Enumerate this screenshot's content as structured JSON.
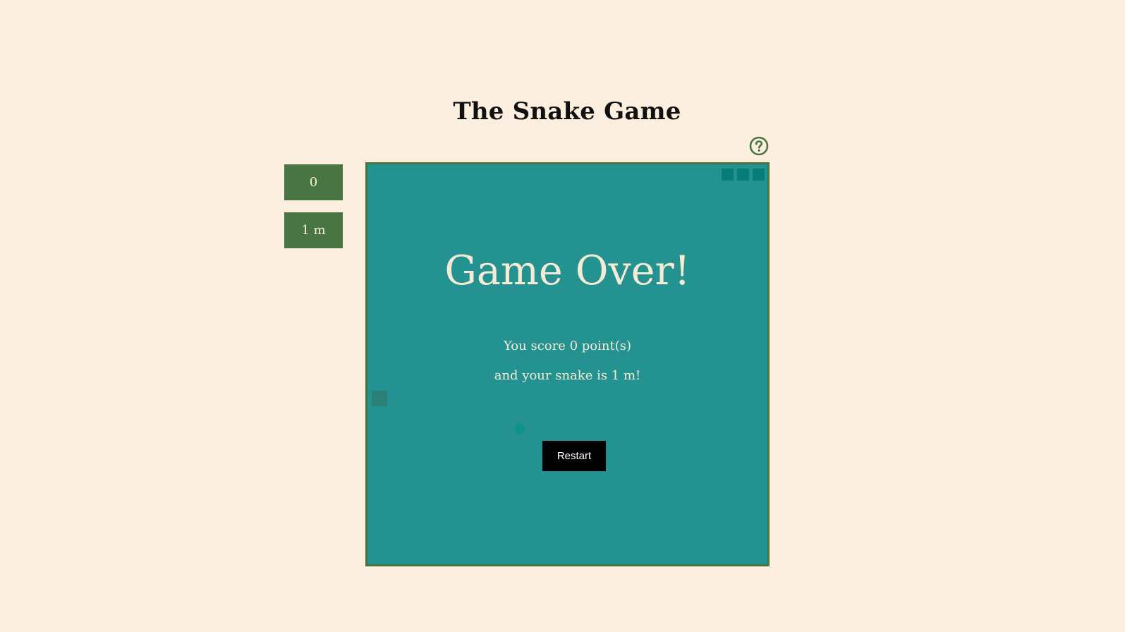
{
  "header": {
    "title": "The Snake Game"
  },
  "help": {
    "icon": "question-circle-icon"
  },
  "stats": {
    "score": "0",
    "length": "1 m"
  },
  "game_over": {
    "title": "Game Over!",
    "score_line": "You score 0 point(s)",
    "length_line": "and your snake is 1 m!",
    "restart_label": "Restart"
  },
  "colors": {
    "background": "#fcefdf",
    "board": "#239290",
    "board_border": "#497543",
    "stat_box": "#497543",
    "text_light": "#f5ead3",
    "button": "#000000"
  }
}
